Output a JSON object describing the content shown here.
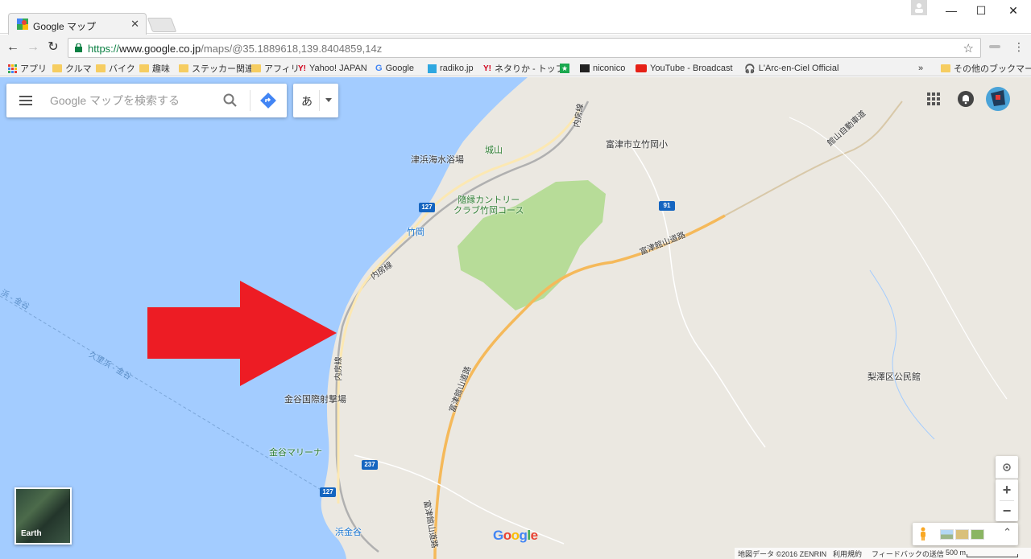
{
  "browser": {
    "tab_title": "Google マップ",
    "tab_close": "✕",
    "url_scheme": "https://",
    "url_host": "www.google.co.jp",
    "url_path": "/maps/@35.1889618,139.8404859,14z",
    "window_minimize": "—",
    "window_maximize": "☐",
    "window_close": "✕"
  },
  "bookmarks": [
    {
      "label": "アプリ",
      "icon": "apps-icon"
    },
    {
      "label": "クルマ",
      "icon": "folder-icon"
    },
    {
      "label": "バイク",
      "icon": "folder-icon"
    },
    {
      "label": "趣味",
      "icon": "folder-icon"
    },
    {
      "label": "ステッカー関連",
      "icon": "folder-icon"
    },
    {
      "label": "アフィリ",
      "icon": "folder-icon"
    },
    {
      "label": "Yahoo! JAPAN",
      "icon": "yahoo-icon"
    },
    {
      "label": "Google",
      "icon": "google-icon"
    },
    {
      "label": "radiko.jp",
      "icon": "radiko-icon"
    },
    {
      "label": "ネタりか - トップ",
      "icon": "yahoo-icon"
    },
    {
      "label": "",
      "icon": "star-icon"
    },
    {
      "label": "niconico",
      "icon": "niconico-icon"
    },
    {
      "label": "YouTube - Broadcast",
      "icon": "youtube-icon"
    },
    {
      "label": "L'Arc-en-Ciel Official",
      "icon": "headphones-icon"
    },
    {
      "label": "»",
      "icon": "overflow-chevron-icon"
    },
    {
      "label": "その他のブックマーク",
      "icon": "folder-icon"
    }
  ],
  "maps": {
    "search_placeholder": "Google マップを検索する",
    "ime_label": "あ",
    "earth_label": "Earth",
    "google_logo": [
      "G",
      "o",
      "o",
      "g",
      "l",
      "e"
    ],
    "zoom_in": "+",
    "zoom_out": "−",
    "expand": "⌃",
    "attribution": {
      "map_data": "地図データ ©2016 ZENRIN",
      "terms": "利用規約",
      "feedback": "フィードバックの送信",
      "scale": "500 m"
    },
    "places": {
      "tsuhama_beach": "津浜海水浴場",
      "shiroyama": "城山",
      "futtsu_school": "富津市立竹岡小",
      "country_club": "隨縁カントリー\nクラブ竹岡コース",
      "takeoka_station": "竹岡",
      "kanaya_shooting": "金谷国際射撃場",
      "kanaya_marina": "金谷マリーナ",
      "hamakanaya_station": "浜金谷",
      "nashizawa_hall": "梨澤区公民館",
      "uchibo_line_1": "内房線",
      "uchibo_line_2": "内房線",
      "uchibo_line_3": "内房線",
      "futtsu_tateyama_road_1": "富津館山道路",
      "futtsu_tateyama_road_2": "富津館山道路",
      "futtsu_tateyama_road_3": "富津館山道路",
      "tateyama_expressway": "館山自動車道",
      "ferry_route_1": "浜 - 金谷",
      "ferry_route_2": "久里浜 - 金谷"
    },
    "route_shields": {
      "r127_a": "127",
      "r127_b": "127",
      "r91": "91",
      "r237": "237"
    }
  },
  "colors": {
    "sea": "#a3ccff",
    "land": "#ebe8e1",
    "park": "#b7dc98",
    "highway": "#f5b95a",
    "arrow": "#ed1c24"
  }
}
